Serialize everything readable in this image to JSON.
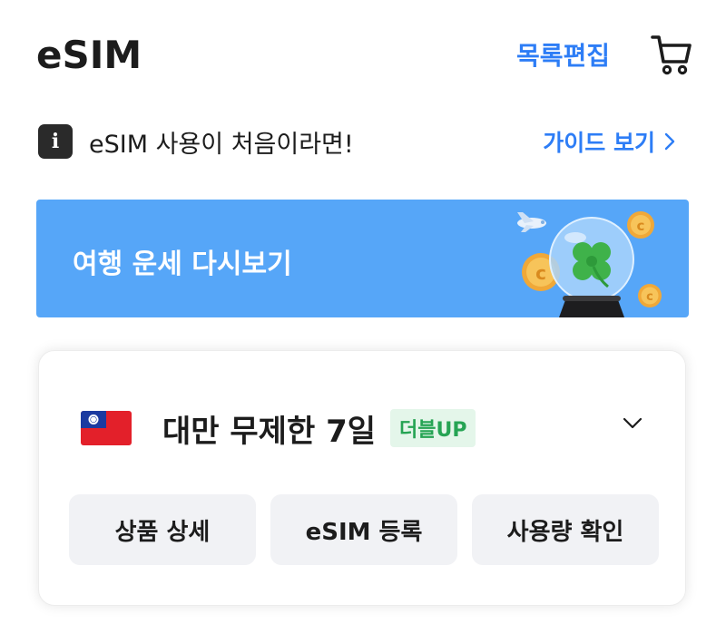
{
  "header": {
    "title": "eSIM",
    "edit_label": "목록편집",
    "cart_icon": "cart-icon"
  },
  "notice": {
    "icon_text": "i",
    "text": "eSIM 사용이 처음이라면!",
    "guide_label": "가이드 보기"
  },
  "banner": {
    "text": "여행 운세 다시보기",
    "background": "#56a6f8"
  },
  "esim_card": {
    "flag": "taiwan-flag",
    "title": "대만 무제한 7일",
    "badge": "더블UP",
    "buttons": [
      {
        "label": "상품 상세"
      },
      {
        "label": "eSIM 등록"
      },
      {
        "label": "사용량 확인"
      }
    ]
  },
  "colors": {
    "accent": "#2d7df6",
    "badge_bg": "#e4f6ea",
    "badge_text": "#26a454"
  }
}
